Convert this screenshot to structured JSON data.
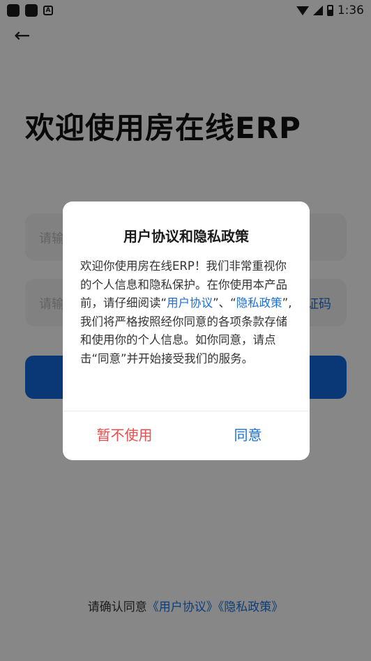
{
  "status_bar": {
    "time": "1:36",
    "left_icons": [
      "android-icon",
      "app-icon",
      "a-icon"
    ],
    "right_icons": [
      "wifi-icon",
      "signal-icon",
      "battery-icon"
    ]
  },
  "page": {
    "title": "欢迎使用房在线ERP",
    "field1_placeholder": "请输",
    "field2_placeholder": "请输",
    "get_code_label": "证码",
    "login_button": "",
    "agreement": {
      "prefix": "请确认同意",
      "user_agreement": "《用户协议》",
      "privacy_policy": "《隐私政策》"
    }
  },
  "dialog": {
    "title": "用户协议和隐私政策",
    "body_part1": "欢迎你使用房在线ERP！我们非常重视你的个人信息和隐私保护。在你使用本产品前，请仔细阅读“",
    "link_user_agreement": "用户协议",
    "body_part2": "”、“",
    "link_privacy_policy": "隐私政策",
    "body_part3": "”, 我们将严格按照经你同意的各项条款存储和使用你的个人信息。如你同意，请点击“同意”并开始接受我们的服务。",
    "cancel_label": "暂不使用",
    "ok_label": "同意"
  },
  "colors": {
    "accent": "#1364d6",
    "link": "#1a6fd8",
    "cancel": "#e94e4e"
  }
}
